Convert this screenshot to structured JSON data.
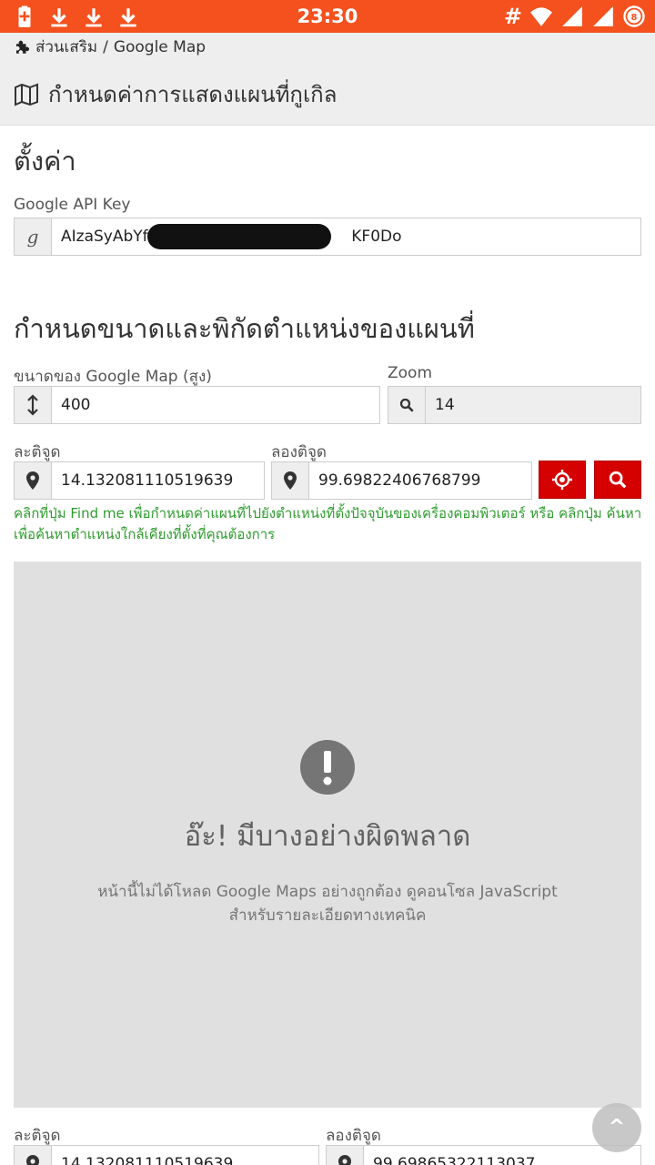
{
  "status_bar": {
    "time": "23:30",
    "battery_level": "8",
    "left_icons": [
      "battery-charging-icon",
      "download-icon",
      "download-icon",
      "download-icon"
    ],
    "right_icons": [
      "hash-icon",
      "wifi-icon",
      "signal-icon",
      "signal-icon",
      "battery-saver-icon"
    ],
    "color": "#f4511e"
  },
  "breadcrumb": {
    "icon": "puzzle-icon",
    "parent": "ส่วนเสริม",
    "separator": "/",
    "current": "Google Map"
  },
  "page": {
    "icon": "map-icon",
    "title": "กำหนดค่าการแสดงแผนที่กูเกิล"
  },
  "settings": {
    "title": "ตั้งค่า",
    "api_key_label": "Google API Key",
    "api_key_icon": "google-icon",
    "api_key_prefix": "AIzaSyAbYf59",
    "api_key_suffix": "KF0Do"
  },
  "size_section": {
    "title": "กำหนดขนาดและพิกัดตำแหน่งของแผนที่",
    "height_label": "ขนาดของ Google Map (สูง)",
    "height_value": "400",
    "zoom_label": "Zoom",
    "zoom_value": "14",
    "lat_label": "ละติจูด",
    "lat_value": "14.132081110519639",
    "lng_label": "ลองติจูด",
    "lng_value": "99.69822406768799",
    "find_me_icon": "crosshair-icon",
    "search_icon": "search-icon",
    "help": "คลิกที่ปุ่ม Find me เพื่อกำหนดค่าแผนที่ไปยังตำแหน่งที่ตั้งปัจจุบันของเครื่องคอมพิวเตอร์ หรือ คลิกปุ่ม ค้นหา เพื่อค้นหาตำแหน่งใกล้เคียงที่ตั้งที่คุณต้องการ",
    "help_color": "#2e9b2e",
    "accent": "#d50000"
  },
  "map_error": {
    "icon": "alert-icon",
    "title": "อ๊ะ! มีบางอย่างผิดพลาด",
    "line1": "หน้านี้ไม่ได้โหลด Google Maps อย่างถูกต้อง ดูคอนโซล JavaScript",
    "line2": "สำหรับรายละเอียดทางเทคนิค"
  },
  "bottom": {
    "lat_label": "ละติจูด",
    "lat_value": "14.132081110519639",
    "lng_label": "ลองติจูด",
    "lng_value": "99.69865322113037"
  },
  "scroll_top": "^"
}
